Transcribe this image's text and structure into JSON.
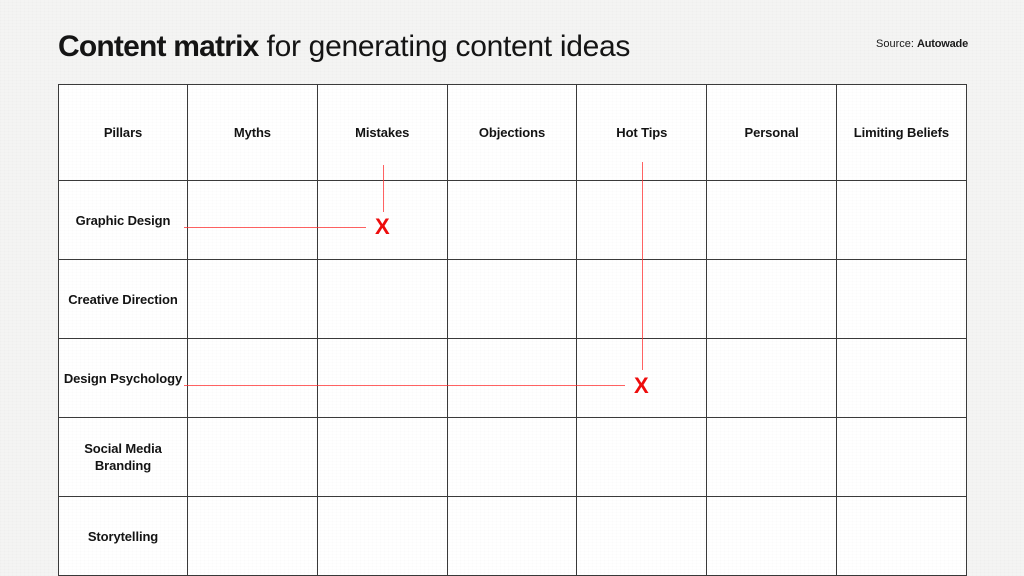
{
  "header": {
    "title_strong": "Content matrix",
    "title_rest": " for generating content ideas",
    "source_label": "Source:",
    "source_name": "Autowade"
  },
  "matrix": {
    "columns": [
      "Pillars",
      "Myths",
      "Mistakes",
      "Objections",
      "Hot Tips",
      "Personal",
      "Limiting Beliefs"
    ],
    "rows": [
      {
        "label": "Graphic Design"
      },
      {
        "label": "Creative Direction"
      },
      {
        "label": "Design Psychology"
      },
      {
        "label": "Social Media Branding"
      },
      {
        "label": "Storytelling"
      }
    ]
  },
  "annotations": {
    "markers": [
      {
        "symbol": "X",
        "column": "Mistakes",
        "row": "Graphic Design"
      },
      {
        "symbol": "X",
        "column": "Hot Tips",
        "row": "Design Psychology"
      }
    ],
    "line_color": "#ff2e2e",
    "marker_color": "#ef0c0c"
  },
  "colors": {
    "background": "#f4f4f3",
    "pillars_fill": "#ffc71a",
    "header_fill": "#f8e39a",
    "cell_fill": "#ffffff",
    "border": "#3a3a3a",
    "text": "#141414"
  }
}
